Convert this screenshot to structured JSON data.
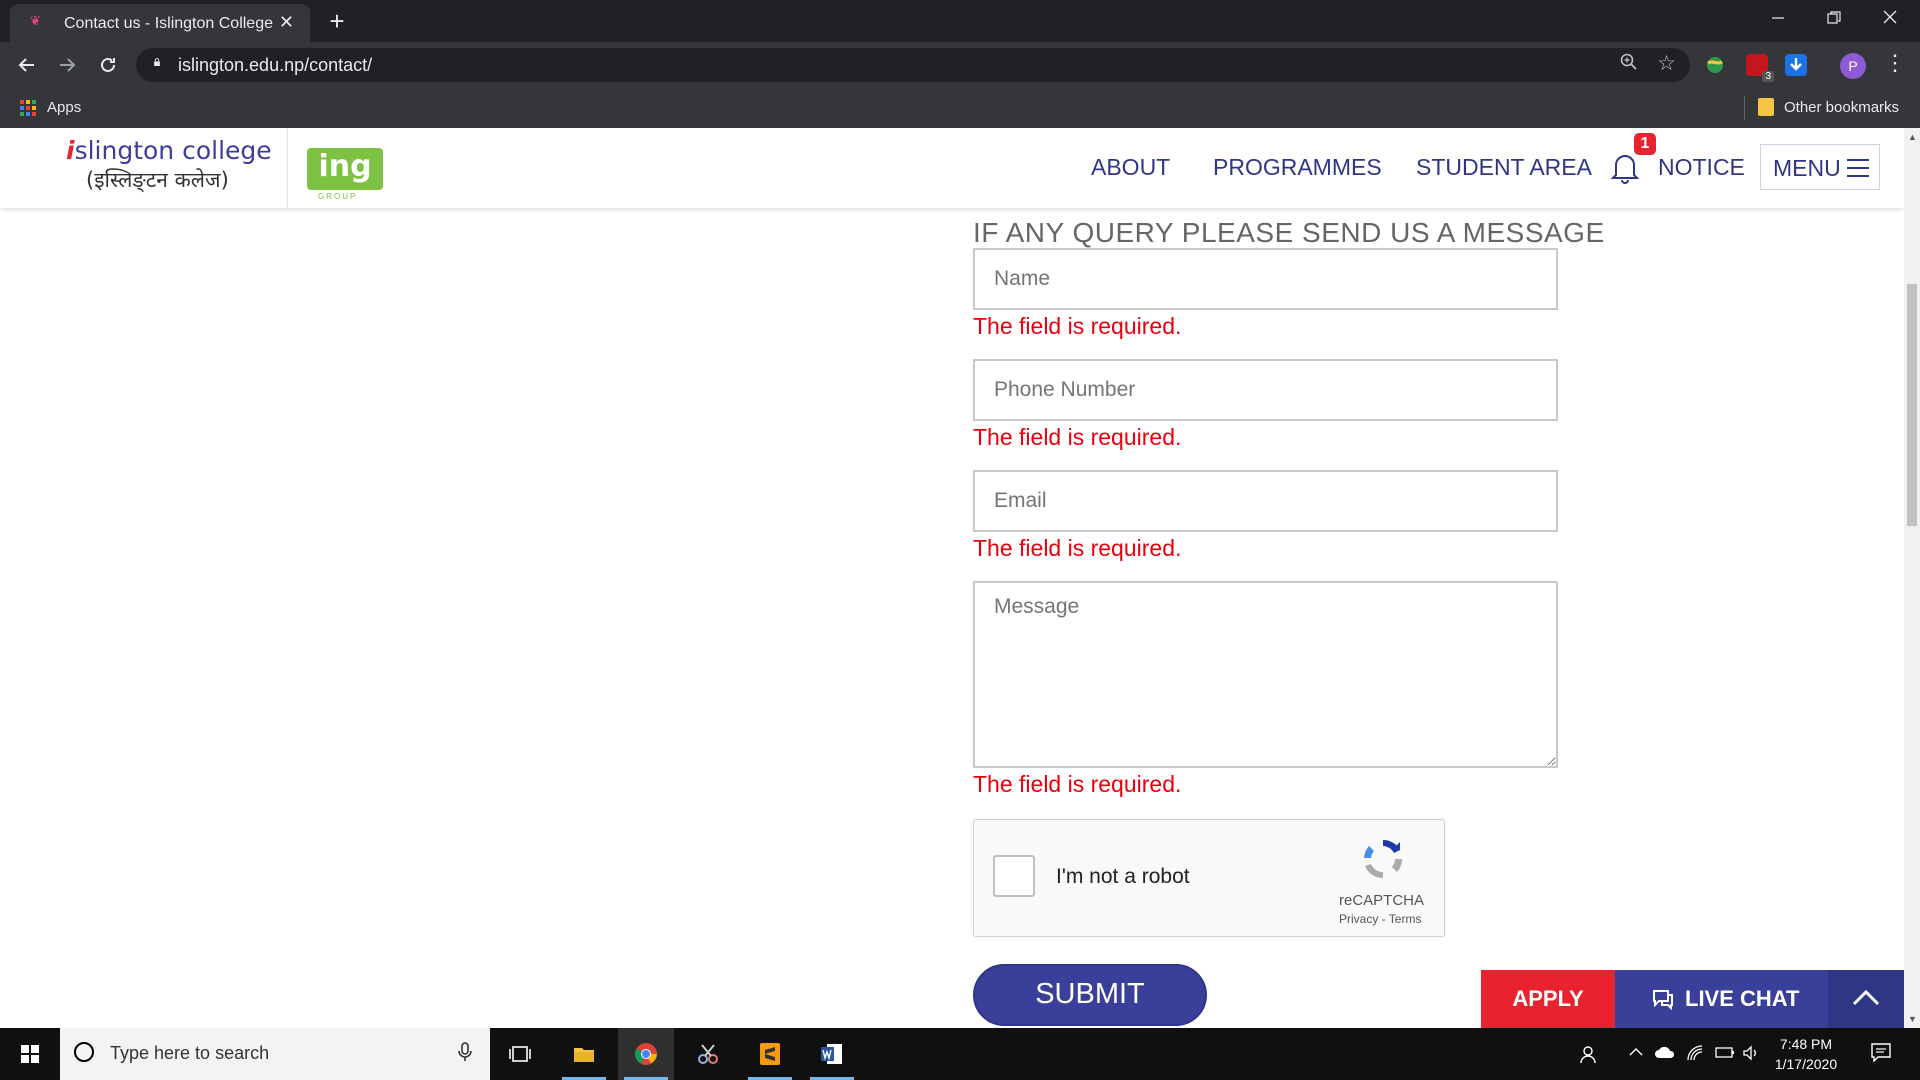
{
  "browser": {
    "tab_title": "Contact us - Islington College",
    "tab_close": "✕",
    "new_tab": "+",
    "url": "islington.edu.np/contact/",
    "profile_initial": "P",
    "bookmarks": {
      "apps": "Apps",
      "other": "Other bookmarks"
    },
    "ext_badge": "3"
  },
  "header": {
    "logo_i": "i",
    "logo_rest": "slington college",
    "logo_devanagari": "(इस्लिङ्टन कलेज)",
    "ing_logo": "ing",
    "ing_sub": "GROUP",
    "nav": [
      "ABOUT",
      "PROGRAMMES",
      "STUDENT AREA",
      "NOTICE"
    ],
    "notice_badge": "1",
    "menu_label": "MENU"
  },
  "form": {
    "title": "IF ANY QUERY PLEASE SEND US A MESSAGE",
    "name_placeholder": "Name",
    "phone_placeholder": "Phone Number",
    "email_placeholder": "Email",
    "message_placeholder": "Message",
    "error": "The field is required.",
    "captcha_label": "I'm not a robot",
    "captcha_brand": "reCAPTCHA",
    "captcha_links": "Privacy - Terms",
    "submit": "SUBMIT"
  },
  "floating": {
    "apply": "APPLY",
    "live_chat": "LIVE CHAT"
  },
  "taskbar": {
    "search_placeholder": "Type here to search",
    "time": "7:48 PM",
    "date": "1/17/2020"
  },
  "colors": {
    "brand_blue": "#3a3f9a",
    "brand_red": "#e8232f",
    "ing_green": "#7dc242",
    "error_red": "#e8000d"
  }
}
